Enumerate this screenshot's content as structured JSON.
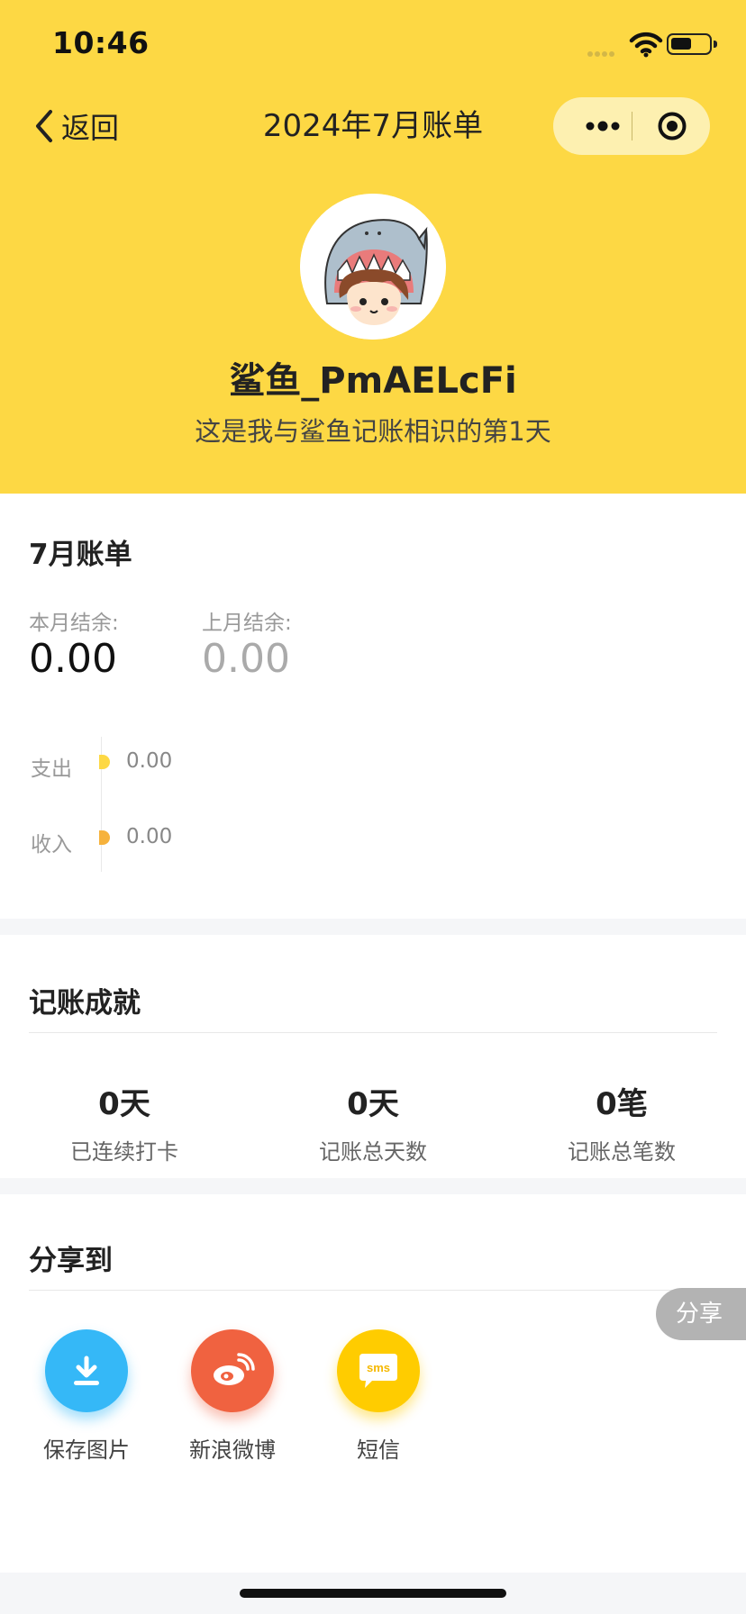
{
  "status_bar": {
    "time": "10:46"
  },
  "nav": {
    "back_label": "返回",
    "title": "2024年7月账单"
  },
  "profile": {
    "username": "鲨鱼_PmAELcFi",
    "tagline": "这是我与鲨鱼记账相识的第1天"
  },
  "bill": {
    "title": "7月账单",
    "this_month_label": "本月结余:",
    "this_month_value": "0.00",
    "last_month_label": "上月结余:",
    "last_month_value": "0.00",
    "rows": [
      {
        "label": "支出",
        "value": "0.00",
        "color": "#fdd844"
      },
      {
        "label": "收入",
        "value": "0.00",
        "color": "#f6b23c"
      }
    ]
  },
  "achievements": {
    "title": "记账成就",
    "stats": [
      {
        "value": "0天",
        "label": "已连续打卡"
      },
      {
        "value": "0天",
        "label": "记账总天数"
      },
      {
        "value": "0笔",
        "label": "记账总笔数"
      }
    ]
  },
  "share": {
    "title": "分享到",
    "items": [
      {
        "label": "保存图片",
        "icon": "download-icon",
        "color": "#35b8f7"
      },
      {
        "label": "新浪微博",
        "icon": "weibo-icon",
        "color": "#f06240"
      },
      {
        "label": "短信",
        "icon": "sms-icon",
        "color": "#ffcc00"
      }
    ],
    "float_button": "分享",
    "sms_icon_text": "sms"
  },
  "theme": {
    "accent": "#fdd844",
    "background": "#f5f6f8"
  }
}
